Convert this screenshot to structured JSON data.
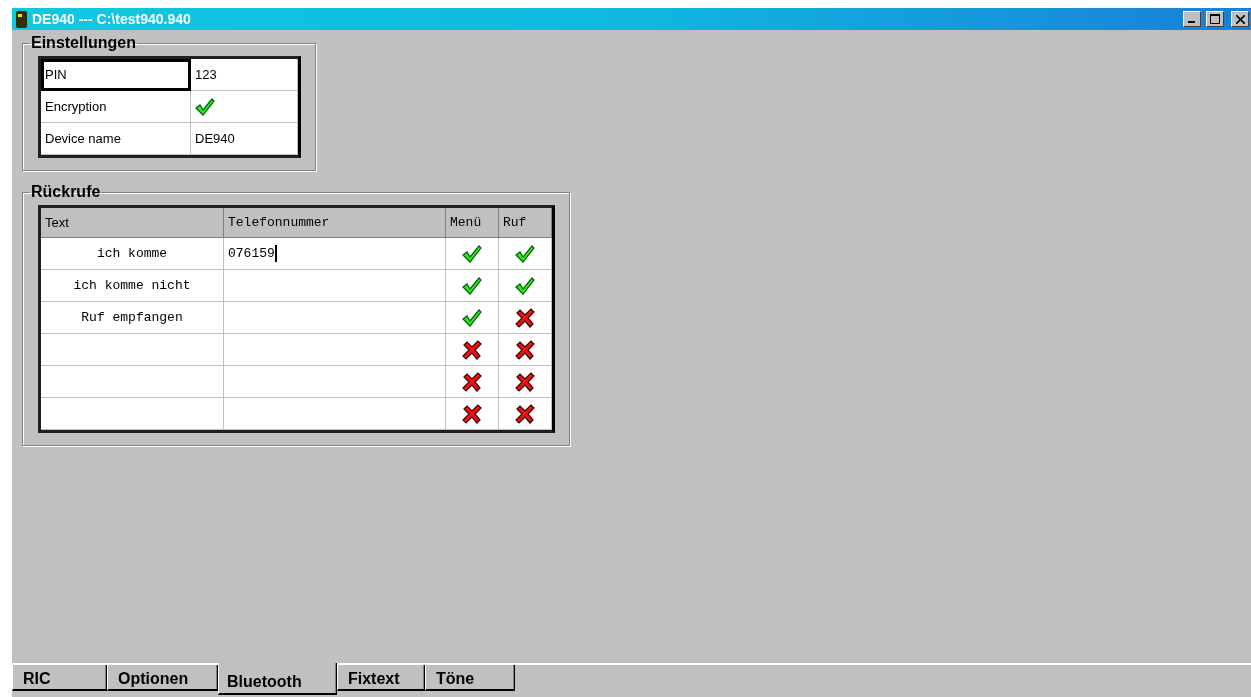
{
  "window": {
    "title": "DE940 --- C:\\test940.940"
  },
  "settings": {
    "title": "Einstellungen",
    "rows": [
      {
        "kind": "text",
        "label": "PIN",
        "value": "123",
        "selected": true
      },
      {
        "kind": "check",
        "label": "Encryption",
        "checked": true,
        "selected": false
      },
      {
        "kind": "text",
        "label": "Device name",
        "value": "DE940",
        "selected": false
      }
    ]
  },
  "callbacks": {
    "title": "Rückrufe",
    "columns": [
      "Text",
      "Telefonnummer",
      "Menü",
      "Ruf"
    ],
    "rows": [
      {
        "text": "ich komme",
        "phone": "076159",
        "editing": true,
        "menu": true,
        "ruf": true
      },
      {
        "text": "ich komme nicht",
        "menu": true,
        "ruf": true
      },
      {
        "text": "Ruf empfangen",
        "menu": true,
        "ruf": false
      },
      {
        "menu": false,
        "ruf": false
      },
      {
        "menu": false,
        "ruf": false
      },
      {
        "menu": false,
        "ruf": false
      }
    ]
  },
  "tabs": [
    {
      "label": "RIC",
      "selected": false
    },
    {
      "label": "Optionen",
      "selected": false
    },
    {
      "label": "Bluetooth",
      "selected": true
    },
    {
      "label": "Fixtext",
      "selected": false
    },
    {
      "label": "Töne",
      "selected": false
    }
  ]
}
